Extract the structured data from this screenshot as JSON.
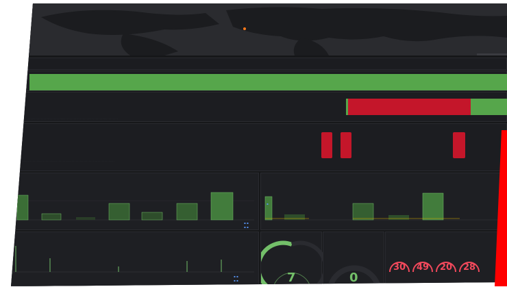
{
  "map_panel": {
    "attribution": ""
  },
  "status_panels": [
    {
      "state": "ok",
      "color": "#56a64b"
    },
    {
      "state": "mixed",
      "ok_color": "#56a64b",
      "alert_color": "#c4162a"
    }
  ],
  "events_panel": {
    "title": "",
    "highlight_color": "#c4162a"
  },
  "bar_panel_left": {
    "title": ""
  },
  "bar_panel_right": {
    "title": ""
  },
  "bottom_left_panel": {
    "title": ""
  },
  "gauge_panel_1": {
    "title": "",
    "value": "7",
    "color": "#73bf69"
  },
  "gauge_panel_2": {
    "title": "",
    "value": "0",
    "color": "#73bf69"
  },
  "gauge_panel_3": {
    "title": "",
    "gauges": [
      {
        "value": "30",
        "label": ""
      },
      {
        "value": "49",
        "label": ""
      },
      {
        "value": "20",
        "label": ""
      },
      {
        "value": "28",
        "label": ""
      }
    ],
    "color": "#f2495c"
  },
  "accent_red": "#ff0000"
}
